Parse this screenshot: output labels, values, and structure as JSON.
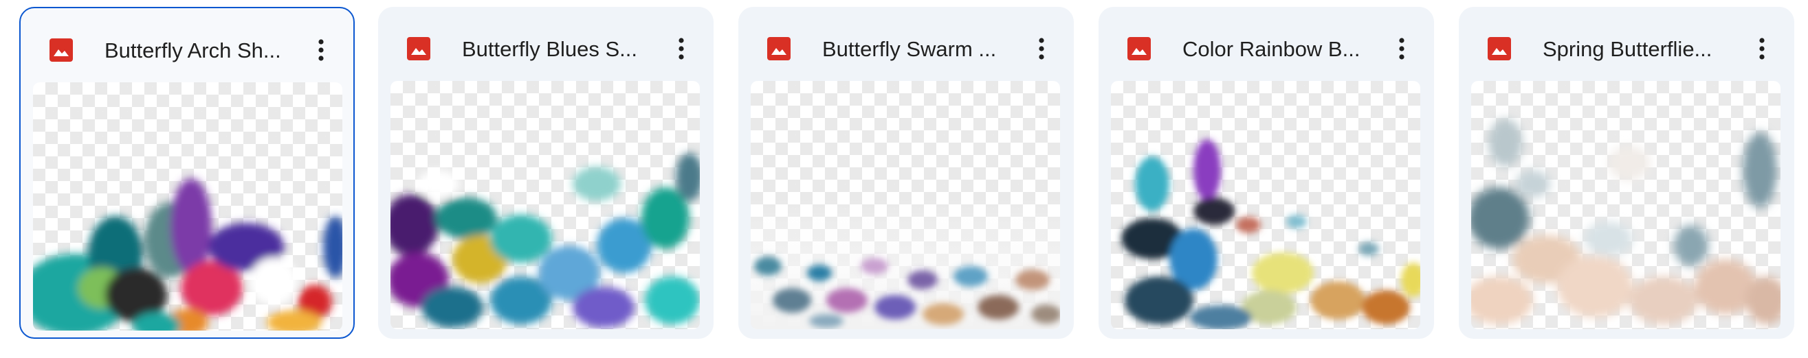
{
  "files": [
    {
      "title": "Butterfly Arch Sh...",
      "icon": "image-file-icon",
      "selected": true
    },
    {
      "title": "Butterfly Blues S...",
      "icon": "image-file-icon",
      "selected": false
    },
    {
      "title": "Butterfly Swarm ...",
      "icon": "image-file-icon",
      "selected": false
    },
    {
      "title": "Color Rainbow B...",
      "icon": "image-file-icon",
      "selected": false
    },
    {
      "title": "Spring Butterflie...",
      "icon": "image-file-icon",
      "selected": false
    }
  ],
  "colors": {
    "card_background": "#f0f4f9",
    "selected_border": "#0b57d0",
    "image_icon": "#d93025",
    "title_text": "#1f1f1f",
    "more_icon": "#1f1f1f"
  }
}
